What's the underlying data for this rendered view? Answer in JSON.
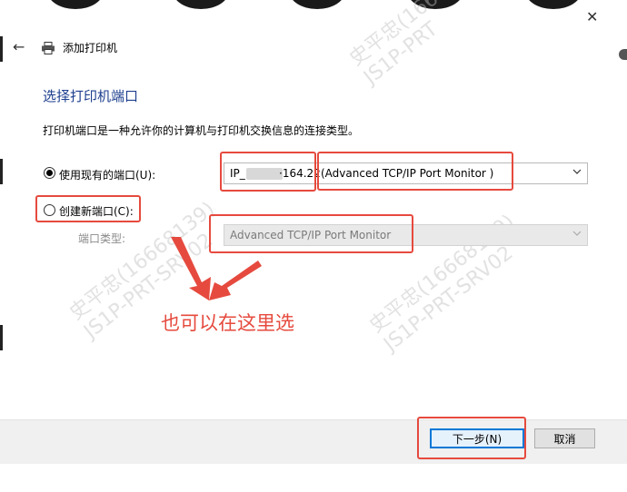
{
  "dialog": {
    "title": "添加打印机",
    "section_title": "选择打印机端口",
    "description": "打印机端口是一种允许你的计算机与打印机交换信息的连接类型。"
  },
  "options": {
    "use_existing_label": "使用现有的端口(U):",
    "create_new_label": "创建新端口(C):",
    "port_type_label": "端口类型:"
  },
  "existing_port": {
    "ip_prefix": "IP_",
    "ip_suffix": "·164.22",
    "monitor": "(Advanced TCP/IP Port Monitor )"
  },
  "port_type": {
    "selected": "Advanced TCP/IP Port Monitor"
  },
  "buttons": {
    "next": "下一步(N)",
    "cancel": "取消"
  },
  "annotation": {
    "text": "也可以在这里选"
  },
  "watermarks": [
    {
      "line1": "史平忠(1666",
      "line2": "JS1P-PRT"
    },
    {
      "line1": "史平忠(16668139)",
      "line2": "JS1P-PRT-SRV02"
    },
    {
      "line1": "史平忠(16668139)",
      "line2": "JS1P-PRT-SRV02"
    }
  ],
  "colors": {
    "accent_red": "#e64a3e",
    "title_blue": "#1e3f8f",
    "primary_border": "#0078d7"
  }
}
